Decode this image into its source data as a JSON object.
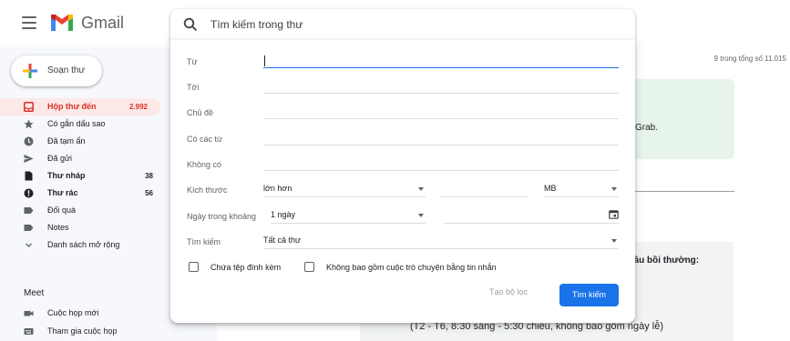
{
  "header": {
    "brand": "Gmail",
    "search_placeholder": "Tìm kiếm trong thư"
  },
  "sidebar": {
    "compose_label": "Soạn thư",
    "items": [
      {
        "label": "Hộp thư đến",
        "count": "2.992",
        "icon": "inbox-icon"
      },
      {
        "label": "Có gắn dấu sao",
        "count": "",
        "icon": "star-icon"
      },
      {
        "label": "Đã tạm ẩn",
        "count": "",
        "icon": "clock-icon"
      },
      {
        "label": "Đã gửi",
        "count": "",
        "icon": "send-icon"
      },
      {
        "label": "Thư nháp",
        "count": "38",
        "icon": "draft-icon"
      },
      {
        "label": "Thư rác",
        "count": "56",
        "icon": "spam-icon"
      },
      {
        "label": "Đối quà",
        "count": "",
        "icon": "label-icon"
      },
      {
        "label": "Notes",
        "count": "",
        "icon": "label-icon"
      },
      {
        "label": "Danh sách mở rộng",
        "count": "",
        "icon": "chevron-down-icon"
      }
    ],
    "meet": {
      "title": "Meet",
      "items": [
        {
          "label": "Cuộc họp mới",
          "icon": "video-icon"
        },
        {
          "label": "Tham gia cuộc họp",
          "icon": "keyboard-icon"
        }
      ]
    }
  },
  "main": {
    "pagination": "9 trong tổng số 11.015",
    "snippet_grab": "Grab.",
    "snippet_claim": "cầu bồi thường:",
    "snippet_hours": "(T2 - T6, 8:30 sáng - 5:30 chiều, không bao gồm ngày lễ)"
  },
  "advanced_search": {
    "from_label": "Từ",
    "to_label": "Tới",
    "subject_label": "Chủ đề",
    "has_words_label": "Có các từ",
    "no_words_label": "Không có",
    "size_label": "Kích thước",
    "size_operator": "lớn hơn",
    "size_unit": "MB",
    "date_label": "Ngày trong khoảng",
    "date_range": "1 ngày",
    "search_in_label": "Tìm kiếm",
    "search_in_value": "Tất cả thư",
    "has_attachment_label": "Chứa tệp đính kèm",
    "exclude_chats_label": "Không bao gồm cuộc trò chuyện bằng tin nhắn",
    "create_filter_label": "Tạo bộ lọc",
    "search_button_label": "Tìm kiếm"
  },
  "colors": {
    "accent": "#1a73e8",
    "active_nav": "#d93025",
    "active_nav_bg": "#fce8e6"
  }
}
